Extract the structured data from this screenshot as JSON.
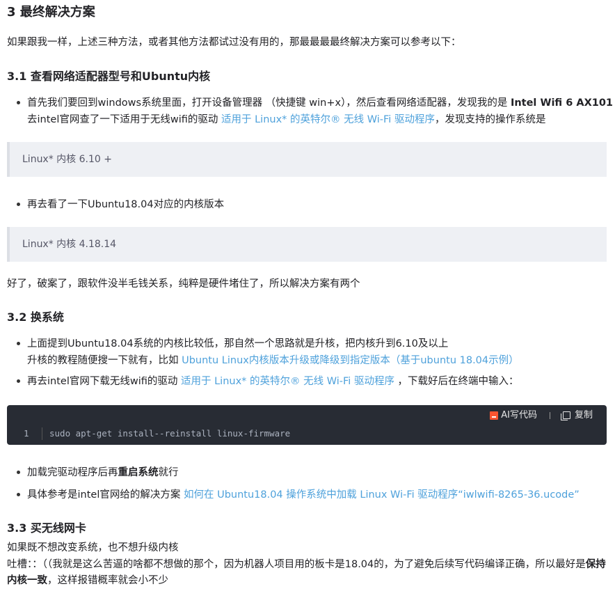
{
  "section3": {
    "title": "3 最终解决方案",
    "intro": "如果跟我一样，上述三种方法，或者其他方法都试过没有用的，那最最最最终解决方案可以参考以下："
  },
  "section31": {
    "title": "3.1 查看网络适配器型号和Ubuntu内核",
    "bullet1": {
      "line1_text": "首先我们要回到windows系统里面，打开设备管理器 （快捷键 win+x），然后查看网络适配器，发现我的是 ",
      "line1_bold": "Intel Wifi 6 AX101",
      "line2_text": "去intel官网查了一下适用于无线wifi的驱动 ",
      "line2_link": "适用于 Linux* 的英特尔® 无线 Wi-Fi 驱动程序",
      "line2_tail": "，发现支持的操作系统是"
    },
    "quote1": "Linux* 内核 6.10 +",
    "bullet2": "再去看了一下Ubuntu18.04对应的内核版本",
    "quote2": "Linux* 内核 4.18.14",
    "conclusion": "好了，破案了，跟软件没半毛钱关系，纯粹是硬件堵住了，所以解决方案有两个"
  },
  "section32": {
    "title": "3.2 换系统",
    "bullet1": {
      "line1": "上面提到Ubuntu18.04系统的内核比较低，那自然一个思路就是升核，把内核升到6.10及以上",
      "line2_text": "升核的教程随便搜一下就有，比如 ",
      "line2_link": "Ubuntu Linux内核版本升级或降级到指定版本（基于ubuntu 18.04示例）"
    },
    "bullet2": {
      "text": "再去intel官网下载无线wifi的驱动 ",
      "link": "适用于 Linux* 的英特尔® 无线 Wi-Fi 驱动程序",
      "tail": " ，下载好后在终端中输入："
    },
    "code": {
      "ai_label": "AI写代码",
      "copy_label": "复制",
      "line_number": "1",
      "line": "sudo apt-get install--reinstall linux-firmware"
    },
    "bullet3": {
      "pre": "加载完驱动程序后再",
      "bold": "重启系统",
      "post": "就行"
    },
    "bullet4": {
      "text": "具体参考是intel官网给的解决方案 ",
      "link": "如何在 Ubuntu18.04 操作系统中加载 Linux Wi-Fi 驱动程序“iwlwifi-8265-36.ucode”"
    }
  },
  "section33": {
    "title": "3.3 买无线网卡",
    "line1": "如果既不想改变系统，也不想升级内核",
    "line2_text": "吐槽：：（（我就是这么苦逼的啥都不想做的那个，因为机器人项目用的板卡是18.04的，为了避免后续写代码编译正确，所以最好是",
    "line2_bold": "保持",
    "line3_bold": "内核一致",
    "line3_text": "，这样报错概率就会小不少"
  },
  "colors": {
    "link": "#4ea1db",
    "code_bg": "#282c34",
    "quote_bg": "#eef0f4",
    "ai_icon": "#fc5531"
  }
}
